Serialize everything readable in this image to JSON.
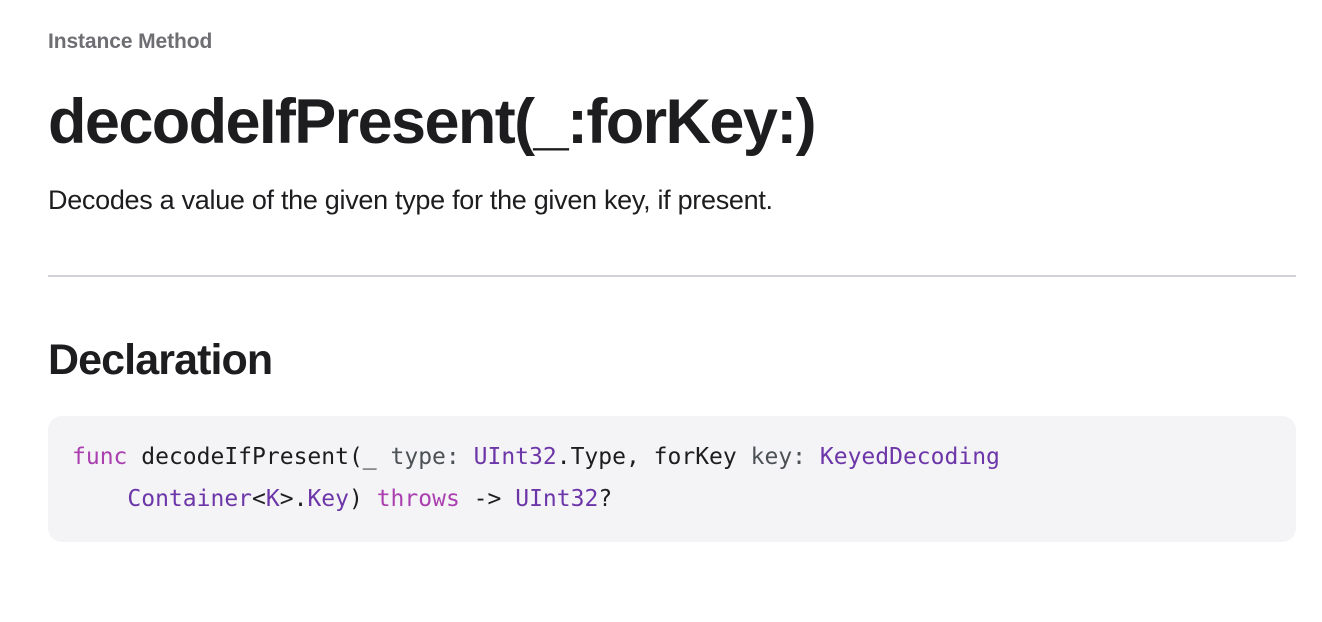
{
  "eyebrow": "Instance Method",
  "title": "decodeIfPresent(_:forKey:)",
  "abstract": "Decodes a value of the given type for the given key, if present.",
  "sections": [
    {
      "heading": "Declaration",
      "code": {
        "lines": [
          [
            {
              "text": "func",
              "kind": "keyword"
            },
            {
              "text": " ",
              "kind": "plain"
            },
            {
              "text": "decodeIfPresent(_",
              "kind": "plain"
            },
            {
              "text": " ",
              "kind": "plain"
            },
            {
              "text": "type:",
              "kind": "param"
            },
            {
              "text": " ",
              "kind": "plain"
            },
            {
              "text": "UInt32",
              "kind": "type"
            },
            {
              "text": ".Type,",
              "kind": "plain"
            },
            {
              "text": " ",
              "kind": "plain"
            },
            {
              "text": "forKey",
              "kind": "plain"
            },
            {
              "text": " ",
              "kind": "plain"
            },
            {
              "text": "key:",
              "kind": "param"
            },
            {
              "text": " ",
              "kind": "plain"
            },
            {
              "text": "KeyedDecoding",
              "kind": "type"
            }
          ],
          [
            {
              "text": "    ",
              "kind": "plain"
            },
            {
              "text": "Container",
              "kind": "type"
            },
            {
              "text": "<",
              "kind": "plain"
            },
            {
              "text": "K",
              "kind": "type"
            },
            {
              "text": ">.",
              "kind": "plain"
            },
            {
              "text": "Key",
              "kind": "type"
            },
            {
              "text": ")",
              "kind": "plain"
            },
            {
              "text": " ",
              "kind": "plain"
            },
            {
              "text": "throws",
              "kind": "keyword"
            },
            {
              "text": " ",
              "kind": "plain"
            },
            {
              "text": "->",
              "kind": "plain"
            },
            {
              "text": " ",
              "kind": "plain"
            },
            {
              "text": "UInt32",
              "kind": "type"
            },
            {
              "text": "?",
              "kind": "plain"
            }
          ]
        ],
        "plain_text": "func decodeIfPresent(_ type: UInt32.Type, forKey key: KeyedDecodingContainer<K>.Key) throws -> UInt32?"
      }
    }
  ],
  "colors": {
    "keyword": "#aa3faf",
    "type": "#6c36a9",
    "plain": "#1d1d1f",
    "param": "#4c5155",
    "eyebrow": "#6e6e73",
    "divider": "#d2d2d7",
    "code_background": "#f4f4f6",
    "page_background": "#ffffff"
  }
}
